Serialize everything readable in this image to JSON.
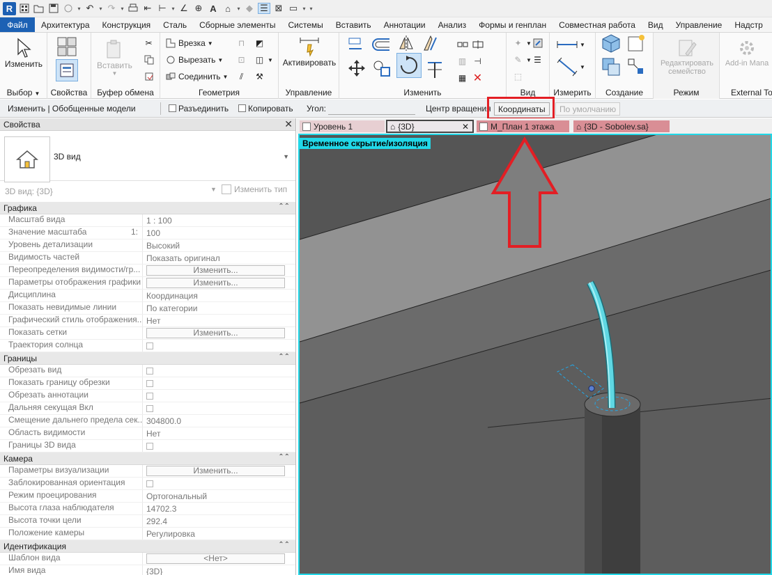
{
  "menu": [
    "Файл",
    "Архитектура",
    "Конструкция",
    "Сталь",
    "Сборные элементы",
    "Системы",
    "Вставить",
    "Аннотации",
    "Анализ",
    "Формы и генплан",
    "Совместная работа",
    "Вид",
    "Управление",
    "Надстр"
  ],
  "qat": {
    "logo": "R",
    "text_tool": "A"
  },
  "ribbon": {
    "modify_label": "Изменить",
    "select_label": "Выбор",
    "properties_label": "Свойства",
    "paste_label": "Вставить",
    "clipboard_label": "Буфер обмена",
    "cope_label": "Врезка",
    "cut_label": "Вырезать",
    "join_label": "Соединить",
    "geometry_label": "Геометрия",
    "activate_label": "Активировать",
    "manage_label": "Управление",
    "modify_panel_label": "Изменить",
    "view_label": "Вид",
    "measure_label": "Измерить",
    "create_label": "Создание",
    "edit_family_label1": "Редактировать",
    "edit_family_label2": "семейство",
    "mode_label": "Режим",
    "addin_label": "Add-in Mana",
    "external_label": "External To"
  },
  "options": {
    "context": "Изменить | Обобщенные модели",
    "disjoin": "Разъединить",
    "copy": "Копировать",
    "angle": "Угол:",
    "rotation_center": "Центр вращения :",
    "coords_button": "Координаты",
    "default_button": "По умолчанию"
  },
  "properties": {
    "title": "Свойства",
    "type_name": "3D вид",
    "instance": "3D вид: {3D}",
    "edit_type": "Изменить тип",
    "groups": [
      {
        "name": "Графика",
        "rows": [
          {
            "k": "Масштаб вида",
            "v": "1 : 100"
          },
          {
            "k": "Значение масштаба",
            "k2": "1:",
            "v": "100"
          },
          {
            "k": "Уровень детализации",
            "v": "Высокий"
          },
          {
            "k": "Видимость частей",
            "v": "Показать оригинал"
          },
          {
            "k": "Переопределения видимости/гр...",
            "btn": "Изменить..."
          },
          {
            "k": "Параметры отображения графики",
            "btn": "Изменить..."
          },
          {
            "k": "Дисциплина",
            "v": "Координация"
          },
          {
            "k": "Показать невидимые линии",
            "v": "По категории"
          },
          {
            "k": "Графический стиль отображения...",
            "v": "Нет"
          },
          {
            "k": "Показать сетки",
            "btn": "Изменить..."
          },
          {
            "k": "Траектория солнца",
            "cb": true
          }
        ]
      },
      {
        "name": "Границы",
        "rows": [
          {
            "k": "Обрезать вид",
            "cb": true
          },
          {
            "k": "Показать границу обрезки",
            "cb": true
          },
          {
            "k": "Обрезать аннотации",
            "cb": true
          },
          {
            "k": "Дальняя секущая Вкл",
            "cb": true
          },
          {
            "k": "Смещение дальнего предела сек...",
            "v": "304800.0"
          },
          {
            "k": "Область видимости",
            "v": "Нет"
          },
          {
            "k": "Границы 3D вида",
            "cb": true
          }
        ]
      },
      {
        "name": "Камера",
        "rows": [
          {
            "k": "Параметры визуализации",
            "btn": "Изменить..."
          },
          {
            "k": "Заблокированная ориентация",
            "cb": true
          },
          {
            "k": "Режим проецирования",
            "v": "Ортогональный"
          },
          {
            "k": "Высота глаза наблюдателя",
            "v": "14702.3"
          },
          {
            "k": "Высота точки цели",
            "v": "292.4"
          },
          {
            "k": "Положение камеры",
            "v": "Регулировка"
          }
        ]
      },
      {
        "name": "Идентификация",
        "rows": [
          {
            "k": "Шаблон вида",
            "btn": "<Нет>"
          },
          {
            "k": "Имя вида",
            "v": "{3D}"
          }
        ]
      }
    ]
  },
  "tabs": [
    {
      "label": "Уровень 1",
      "color": "#e7cfd2"
    },
    {
      "label": "{3D}",
      "color": "#ece7ea",
      "active": true
    },
    {
      "label": "М_План 1 этажа",
      "color": "#d98e95"
    },
    {
      "label": "{3D - Sobolev.sa}",
      "color": "#d98e95"
    }
  ],
  "view": {
    "banner": "Временное скрытие/изоляция",
    "accent": "#21d8e8",
    "highlight": "#e31e24"
  }
}
